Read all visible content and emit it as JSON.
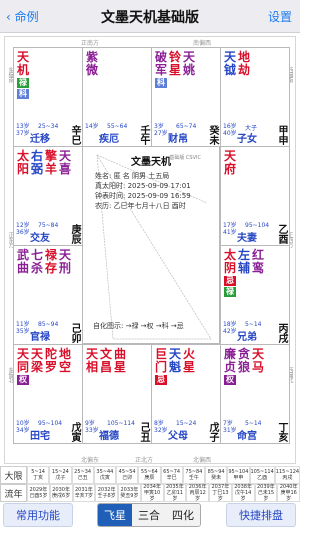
{
  "nav": {
    "back": "命例",
    "title": "文墨天机基础版",
    "settings": "设置"
  },
  "directions": {
    "top_left": "正南方",
    "top_right": "南偏西",
    "right_top": "西偏南",
    "right_mid": "正西方",
    "right_bot": "西偏北",
    "bottom_left": "北偏东",
    "bottom_mid": "正北方",
    "bottom_right": "北偏西",
    "left_top": "东偏南",
    "left_mid": "正东方",
    "left_bot": "东偏北"
  },
  "cells": [
    {
      "id": "si",
      "cols": [
        [
          "天",
          "机"
        ]
      ],
      "colors": [
        "red"
      ],
      "marks": [
        {
          "t": "禄",
          "c": "#2a9d3b"
        },
        {
          "t": "科",
          "c": "#5e7fd8"
        }
      ],
      "age": "13岁\n37岁",
      "age2": "",
      "dx": "25~34",
      "palace": "迁移",
      "stem": "辛巳"
    },
    {
      "id": "wu",
      "cols": [
        [
          "紫",
          "微"
        ]
      ],
      "colors": [
        "purple"
      ],
      "marks": [],
      "age": "14岁",
      "age2": "",
      "dx": "55~64",
      "palace": "疾厄",
      "stem": "壬午"
    },
    {
      "id": "wei",
      "cols": [
        [
          "破",
          "军"
        ],
        [
          "铃",
          "星"
        ],
        [
          "天",
          "姚"
        ]
      ],
      "colors": [
        "purple",
        "red",
        "purple"
      ],
      "marks": [
        {
          "t": "科",
          "c": "#5e7fd8"
        }
      ],
      "age": "3岁\n27岁",
      "age2": "",
      "dx": "65~74",
      "palace": "财帛",
      "stem": "癸未"
    },
    {
      "id": "shen",
      "cols": [
        [
          "天",
          "钺"
        ],
        [
          "地",
          "劫"
        ]
      ],
      "colors": [
        "blue",
        "red"
      ],
      "marks": [],
      "age": "16岁\n40岁",
      "age2": "",
      "dx": "大子",
      "palace": "子女",
      "stem": "甲申"
    },
    {
      "id": "chen",
      "cols": [
        [
          "太",
          "阳"
        ],
        [
          "右",
          "弼"
        ],
        [
          "擎",
          "羊"
        ],
        [
          "天",
          "喜"
        ]
      ],
      "colors": [
        "red",
        "blue",
        "red",
        "purple"
      ],
      "marks": [],
      "age": "12岁\n36岁",
      "age2": "",
      "dx": "75~84",
      "palace": "交友",
      "stem": "庚辰"
    },
    {
      "id": "you",
      "cols": [
        [
          "天",
          "府"
        ]
      ],
      "colors": [
        "red"
      ],
      "marks": [],
      "age": "17岁\n41岁",
      "age2": "",
      "dx": "95~104",
      "palace": "夫妻",
      "stem": "乙酉"
    },
    {
      "id": "mao",
      "cols": [
        [
          "武",
          "曲"
        ],
        [
          "七",
          "杀"
        ],
        [
          "禄",
          "存"
        ],
        [
          "天",
          "刑"
        ]
      ],
      "colors": [
        "purple",
        "purple",
        "red",
        "purple"
      ],
      "marks": [],
      "age": "11岁\n35岁",
      "age2": "",
      "dx": "85~94",
      "palace": "官禄",
      "stem": "己卯"
    },
    {
      "id": "xu",
      "cols": [
        [
          "太",
          "阴"
        ],
        [
          "左",
          "辅"
        ],
        [
          "红",
          "鸾"
        ]
      ],
      "colors": [
        "red",
        "blue",
        "purple"
      ],
      "marks": [
        {
          "t": "忌",
          "c": "#d90f2a"
        },
        {
          "t": "禄",
          "c": "#2a9d3b"
        }
      ],
      "age": "18岁\n42岁",
      "age2": "",
      "dx": "5~14",
      "palace": "兄弟",
      "stem": "丙戌"
    },
    {
      "id": "yin",
      "cols": [
        [
          "天",
          "同"
        ],
        [
          "天",
          "梁"
        ],
        [
          "陀",
          "罗"
        ],
        [
          "地",
          "空"
        ]
      ],
      "colors": [
        "red",
        "red",
        "red",
        "red"
      ],
      "marks": [
        {
          "t": "权",
          "c": "#8a1f95"
        }
      ],
      "age": "10岁\n34岁",
      "age2": "",
      "dx": "95~104",
      "palace": "田宅",
      "stem": "戊寅"
    },
    {
      "id": "chou",
      "cols": [
        [
          "天",
          "相"
        ],
        [
          "文",
          "昌"
        ],
        [
          "曲",
          "星"
        ]
      ],
      "colors": [
        "red",
        "red",
        "red"
      ],
      "marks": [],
      "age": "9岁\n33岁",
      "age2": "",
      "dx": "105~114",
      "palace": "福德",
      "stem": "己丑"
    },
    {
      "id": "zi",
      "cols": [
        [
          "巨",
          "门"
        ],
        [
          "天",
          "魁"
        ],
        [
          "火",
          "星"
        ]
      ],
      "colors": [
        "red",
        "blue",
        "red"
      ],
      "marks": [
        {
          "t": "忌",
          "c": "#d90f2a"
        }
      ],
      "age": "8岁\n32岁",
      "age2": "",
      "dx": "15~24",
      "palace": "父母",
      "stem": "戊子"
    },
    {
      "id": "hai",
      "cols": [
        [
          "廉",
          "贞"
        ],
        [
          "贪",
          "狼"
        ],
        [
          "天",
          "马"
        ]
      ],
      "colors": [
        "purple",
        "purple",
        "red"
      ],
      "marks": [
        {
          "t": "权",
          "c": "#8a1f95"
        }
      ],
      "age": "7岁\n31岁",
      "age2": "",
      "dx": "5~14",
      "palace": "命宫",
      "stem": "丁亥"
    }
  ],
  "center": {
    "title": "文墨天机",
    "version": "基础版 CSVIC",
    "lines": [
      "姓名: 匿 名        阴男  土五局",
      "真太阳时: 2025-09-09 17:01",
      "钟表时间: 2025-09-09 16:59",
      "农历: 乙巳年七月十八日 酉时"
    ],
    "legend": "自化图示: →禄 →权 →科 →忌"
  },
  "limit_row": {
    "label": "大限",
    "cells": [
      "5~14\n丁亥",
      "15~24\n戊子",
      "25~34\n己丑",
      "35~44\n戊寅",
      "45~54\n己卯",
      "55~64\n庚辰",
      "65~74\n辛巳",
      "75~84\n壬午",
      "85~94\n癸未",
      "95~104\n甲申",
      "105~114\n乙酉",
      "115~124\n丙戌"
    ],
    "selected": []
  },
  "year_row": {
    "label": "流年",
    "cells": [
      "2029年\n己酉5岁",
      "2030年\n庚戌6岁",
      "2031年\n辛亥7岁",
      "2032年\n壬子8岁",
      "2033年\n癸丑9岁",
      "2034年\n甲寅10岁",
      "2035年\n乙卯11岁",
      "2036年\n丙辰12岁",
      "2037年\n丁巳13岁",
      "2038年\n戊午14岁",
      "2039年\n己未15岁",
      "2040年\n庚申16岁"
    ],
    "selected": []
  },
  "buttons": {
    "common": "常用功能",
    "seg": [
      "飞星",
      "三合",
      "四化"
    ],
    "seg_active": 0,
    "quick": "快捷排盘"
  },
  "tabs": [
    {
      "label": "命盘",
      "icon": "chart-icon"
    },
    {
      "label": "帮助",
      "icon": "help-icon"
    },
    {
      "label": "关于",
      "icon": "info-icon"
    },
    {
      "label": "退出",
      "icon": "exit-icon"
    }
  ]
}
